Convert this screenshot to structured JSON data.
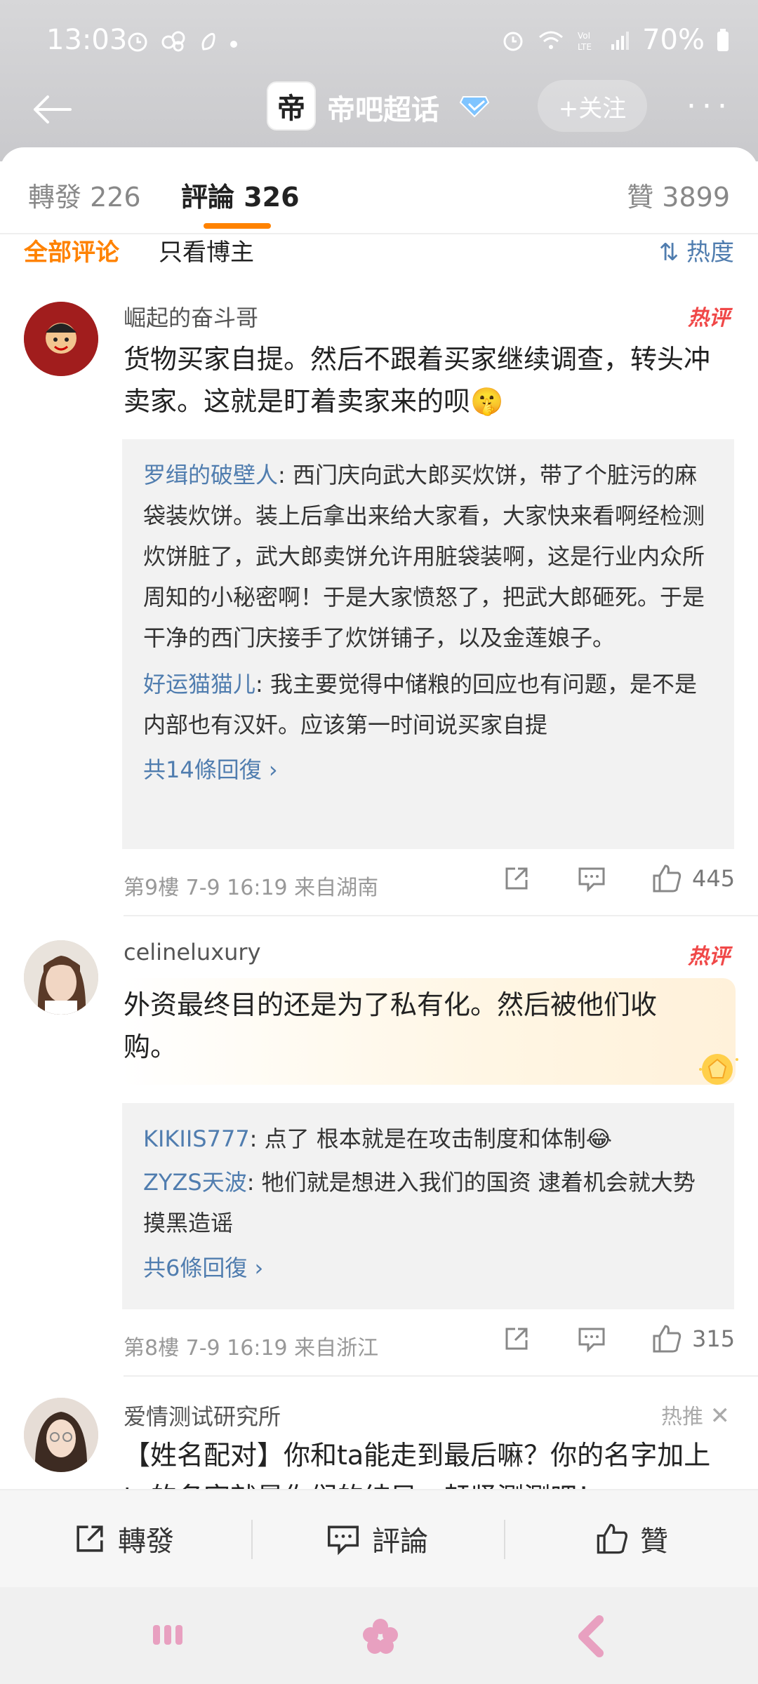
{
  "status_bar": {
    "time": "13:03",
    "battery": "70%"
  },
  "header": {
    "title": "帝吧超话",
    "follow_label": "+关注",
    "more_label": "···",
    "logo_text": "帝"
  },
  "tabs": {
    "repost": "轉發 226",
    "comment": "評論 326",
    "like": "贊 3899"
  },
  "filters": {
    "all": "全部评论",
    "owner_only": "只看博主",
    "sort": "热度"
  },
  "comments": [
    {
      "username": "崛起的奋斗哥",
      "badge": "热评",
      "text": "货物买家自提。然后不跟着买家继续调查，转头冲卖家。这就是盯着卖家来的呗🤫",
      "replies": [
        {
          "user": "罗缉的破壁人",
          "text": ": 西门庆向武大郎买炊饼，带了个脏污的麻袋装炊饼。装上后拿出来给大家看，大家快来看啊经检测炊饼脏了，武大郎卖饼允许用脏袋装啊，这是行业内众所周知的小秘密啊！于是大家愤怒了，把武大郎砸死。于是干净的西门庆接手了炊饼铺子，以及金莲娘子。"
        },
        {
          "user": "好运猫猫儿",
          "text": ": 我主要觉得中储粮的回应也有问题，是不是内部也有汉奸。应该第一时间说买家自提"
        }
      ],
      "more_replies": "共14條回復 ›",
      "meta": "第9樓  7-9 16:19  来自湖南",
      "likes": "445"
    },
    {
      "username": "celineluxury",
      "badge": "热评",
      "text": "外资最终目的还是为了私有化。然后被他们收购。",
      "replies": [
        {
          "user": "KIKIIS777",
          "text": ": 点了 根本就是在攻击制度和体制😂"
        },
        {
          "user": "ZYZS天波",
          "text": ": 牠们就是想进入我们的国资  逮着机会就大势摸黑造谣"
        }
      ],
      "more_replies": "共6條回復 ›",
      "meta": "第8樓  7-9 16:19  来自浙江",
      "likes": "315"
    }
  ],
  "promo": {
    "username": "爱情测试研究所",
    "tag": "热推",
    "text": "【姓名配对】你和ta能走到最后嘛？你的名字加上ta的名字就是你们的结局，赶紧测测吧！"
  },
  "bottom_bar": {
    "repost": "轉發",
    "comment": "評論",
    "like": "贊"
  },
  "colors": {
    "accent": "#ff8200",
    "link": "#507daf",
    "hot": "#f04848"
  }
}
